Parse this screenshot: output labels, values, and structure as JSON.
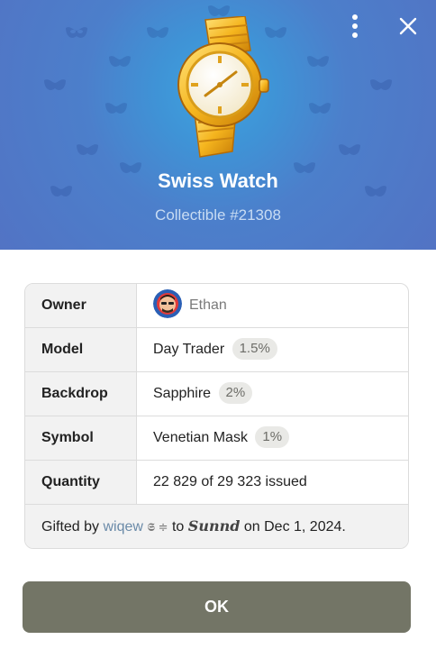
{
  "hero": {
    "title": "Swiss Watch",
    "subtitle": "Collectible #21308",
    "menu_icon": "more-vertical-icon",
    "close_icon": "close-icon",
    "pattern_icon": "venetian-mask-icon",
    "background_color": "#4f79c7"
  },
  "table": {
    "owner": {
      "label": "Owner",
      "name": "Ethan",
      "avatar_icon": "avatar"
    },
    "model": {
      "label": "Model",
      "value": "Day Trader",
      "rarity": "1.5%"
    },
    "backdrop": {
      "label": "Backdrop",
      "value": "Sapphire",
      "rarity": "2%"
    },
    "symbol": {
      "label": "Symbol",
      "value": "Venetian Mask",
      "rarity": "1%"
    },
    "quantity": {
      "label": "Quantity",
      "value": "22 829 of 29 323 issued"
    }
  },
  "footer": {
    "gifted_prefix": "Gifted by",
    "sender": "wiqew",
    "sender_emoji": "𝕾 ≑",
    "to_word": "to",
    "recipient": "Sunnd",
    "date_text": "on Dec 1, 2024."
  },
  "ok_button": {
    "label": "OK",
    "color": "#737566"
  }
}
